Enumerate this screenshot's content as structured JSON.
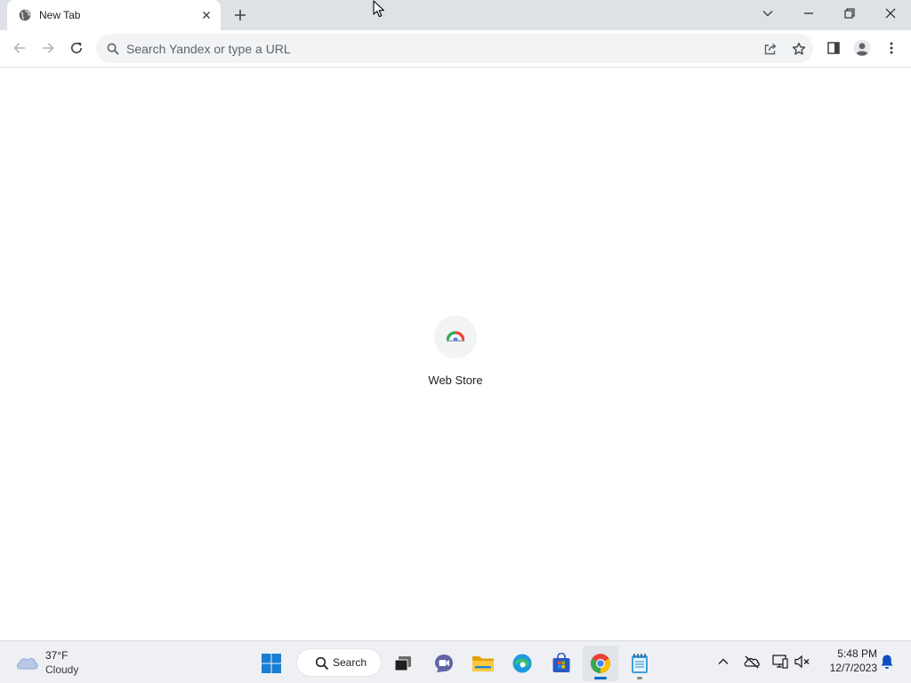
{
  "browser": {
    "tab": {
      "title": "New Tab",
      "favicon": "globe-icon"
    },
    "window_controls": [
      "tab-search-chevron-icon",
      "minimize-icon",
      "restore-icon",
      "close-icon"
    ],
    "toolbar": {
      "nav": [
        "back-arrow-icon",
        "forward-arrow-icon",
        "reload-icon"
      ],
      "omnibox": {
        "placeholder": "Search Yandex or type a URL",
        "value": ""
      },
      "right_icons": [
        "share-icon",
        "star-icon",
        "side-panel-icon",
        "profile-avatar-icon",
        "kebab-menu-icon"
      ]
    },
    "new_tab_page": {
      "shortcuts": [
        {
          "label": "Web Store",
          "icon": "web-store-icon"
        }
      ]
    }
  },
  "taskbar": {
    "weather": {
      "temp": "37°F",
      "condition": "Cloudy",
      "icon": "cloud-icon"
    },
    "search": {
      "label": "Search"
    },
    "apps": [
      "windows-start-icon",
      "task-view-icon",
      "teams-chat-icon",
      "file-explorer-icon",
      "edge-icon",
      "microsoft-store-icon",
      "chrome-icon",
      "notepad-icon"
    ],
    "tray": [
      "chevron-up-icon",
      "onedrive-offline-icon",
      "network-icon",
      "volume-muted-icon",
      "notification-bell-icon"
    ],
    "clock": {
      "time": "5:48 PM",
      "date": "12/7/2023"
    }
  },
  "colors": {
    "tabstrip": "#dee1e6",
    "omnibox": "#f1f3f4",
    "taskbar": "#eef0f3",
    "accent": "#0067c0"
  }
}
